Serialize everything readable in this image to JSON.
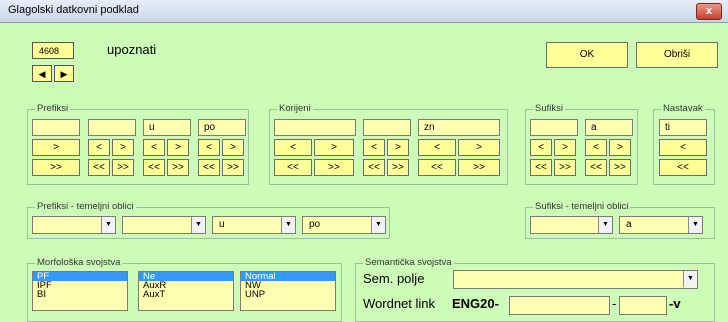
{
  "window": {
    "title": "Glagolski datkovni podklad",
    "close_label": "x"
  },
  "record": {
    "number": "4608",
    "word": "upoznati",
    "prev_label": "◀",
    "next_label": "▶"
  },
  "actions": {
    "ok_label": "OK",
    "delete_label": "Obriši"
  },
  "prefiksi": {
    "legend": "Prefiksi",
    "fields": [
      "",
      "",
      "u",
      "po"
    ]
  },
  "korijeni": {
    "legend": "Korijeni",
    "fields": [
      "",
      "",
      "zn"
    ]
  },
  "sufiksi": {
    "legend": "Sufiksi",
    "fields": [
      "",
      "a"
    ]
  },
  "nastavak": {
    "legend": "Nastavak",
    "field": "ti"
  },
  "buttons": {
    "lt": "<",
    "gt": ">",
    "llt": "<<",
    "ggt": ">>"
  },
  "prefiksi_temeljni": {
    "legend": "Prefiksi - temeljni oblici",
    "values": [
      "",
      "",
      "u",
      "po"
    ]
  },
  "sufiksi_temeljni": {
    "legend": "Sufiksi - temeljni oblici",
    "values": [
      "",
      "a"
    ]
  },
  "morfoloska": {
    "legend": "Morfološka svojstva",
    "list1": [
      "PF",
      "IPF",
      "BI"
    ],
    "list1_selected": "PF",
    "list2": [
      "Ne",
      "AuxR",
      "AuxT"
    ],
    "list2_selected": "Ne",
    "list3": [
      "Normal",
      "NW",
      "UNP"
    ],
    "list3_selected": "Normal"
  },
  "semanticka": {
    "legend": "Semantička svojstva",
    "sem_polje_label": "Sem. polje",
    "sem_polje_value": "",
    "wordnet_label": "Wordnet link",
    "wordnet_prefix": "ENG20-",
    "wordnet_dash": "-",
    "wordnet_suffix": "-v",
    "wordnet_id": "",
    "wordnet_pos": ""
  }
}
